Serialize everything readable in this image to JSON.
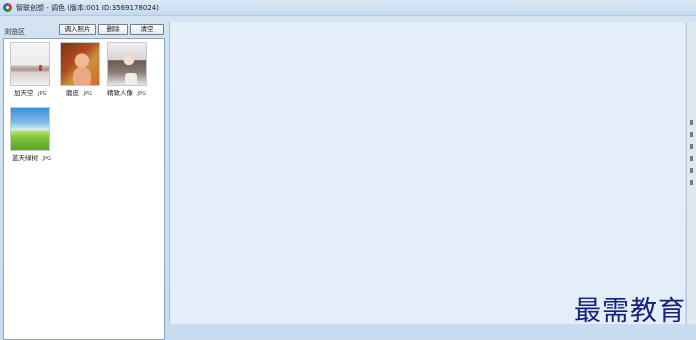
{
  "window": {
    "title": "智联创想 - 调色 (版本:001  ID:3569178024)"
  },
  "panel": {
    "label": "浏览区"
  },
  "toolbar": {
    "import_label": "调入照片",
    "delete_label": "删除",
    "clear_label": "清空"
  },
  "files": [
    {
      "name": "加天空",
      "ext": ".JPG"
    },
    {
      "name": "磨皮",
      "ext": ".JPG"
    },
    {
      "name": "精致人像",
      "ext": ".JPG"
    },
    {
      "name": "蓝天绿树",
      "ext": ".JPG"
    }
  ],
  "watermark": "最需教育"
}
